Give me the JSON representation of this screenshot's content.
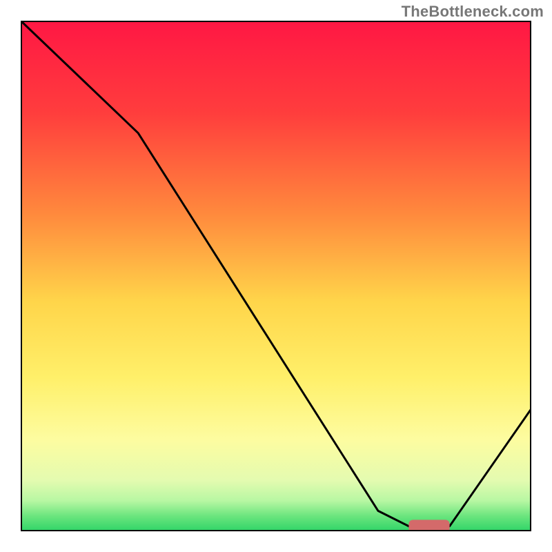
{
  "watermark": "TheBottleneck.com",
  "chart_data": {
    "type": "line",
    "title": "",
    "xlabel": "",
    "ylabel": "",
    "xlim": [
      0,
      100
    ],
    "ylim": [
      0,
      100
    ],
    "grid": false,
    "legend": false,
    "gradient_stops": [
      {
        "offset": 0,
        "color": "#ff1744"
      },
      {
        "offset": 18,
        "color": "#ff3d3d"
      },
      {
        "offset": 38,
        "color": "#ff8a3d"
      },
      {
        "offset": 55,
        "color": "#ffd54a"
      },
      {
        "offset": 70,
        "color": "#fff06a"
      },
      {
        "offset": 82,
        "color": "#fdfca0"
      },
      {
        "offset": 90,
        "color": "#e4fbb0"
      },
      {
        "offset": 94,
        "color": "#b8f7a3"
      },
      {
        "offset": 97,
        "color": "#6be57e"
      },
      {
        "offset": 100,
        "color": "#2fd468"
      }
    ],
    "series": [
      {
        "name": "bottleneck-curve",
        "color": "#000000",
        "x": [
          0,
          23,
          70,
          76,
          84,
          100
        ],
        "values": [
          100,
          78,
          4,
          1,
          1,
          24
        ]
      }
    ],
    "marker": {
      "name": "optimal-range-marker",
      "color": "#d46a6a",
      "x_start": 76,
      "x_end": 84,
      "y": 1,
      "thickness": 2.5
    },
    "axes": {
      "stroke": "#000000",
      "stroke_width": 4
    }
  }
}
